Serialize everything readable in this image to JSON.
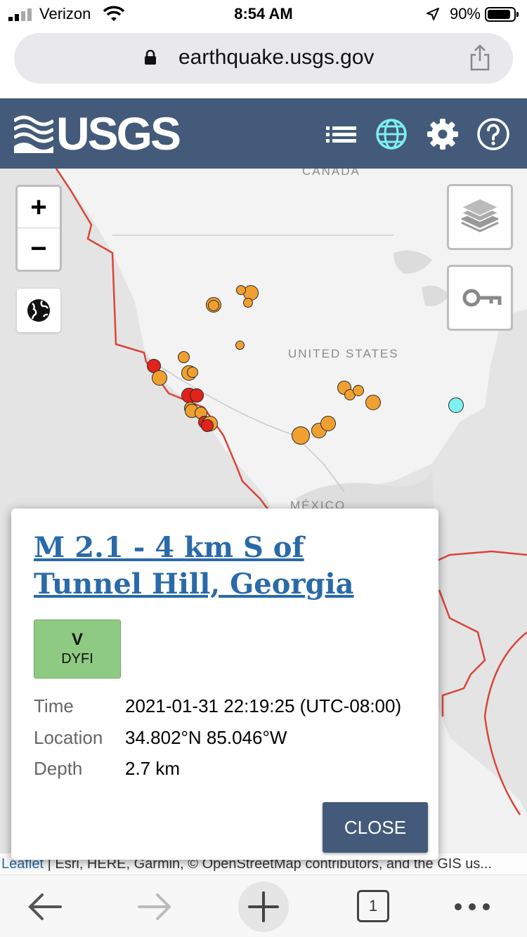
{
  "status_bar": {
    "carrier": "Verizon",
    "time": "8:54 AM",
    "battery_percent": "90%",
    "battery_level": 0.9
  },
  "browser": {
    "url": "earthquake.usgs.gov",
    "tab_count": "1"
  },
  "header": {
    "logo_text": "USGS",
    "icons": [
      "list-icon",
      "globe-icon",
      "gear-icon",
      "help-icon"
    ]
  },
  "map": {
    "labels": {
      "canada": "CANADA",
      "united_states": "UNITED STATES",
      "mexico": "MÉXICO"
    },
    "zoom_in": "+",
    "zoom_out": "−",
    "attribution_leaflet": "Leaflet",
    "attribution_rest": " | Esri, HERE, Garmin, © OpenStreetMap contributors, and the GIS us..."
  },
  "popup": {
    "title": "M 2.1 - 4 km S of Tunnel Hill, Georgia",
    "dyfi_level": "V",
    "dyfi_label": "DYFI",
    "time_label": "Time",
    "time_value": "2021-01-31 22:19:25 (UTC-08:00)",
    "location_label": "Location",
    "location_value": "34.802°N 85.046°W",
    "depth_label": "Depth",
    "depth_value": "2.7 km",
    "close_label": "CLOSE"
  },
  "colors": {
    "header_bg": "#445a7a",
    "link": "#2a6aa8",
    "quake_orange": "#f0a030",
    "quake_red": "#e2231a",
    "quake_selected": "#7df0f0",
    "plate_boundary": "#d9453a",
    "dyfi_badge": "#8fca82"
  }
}
